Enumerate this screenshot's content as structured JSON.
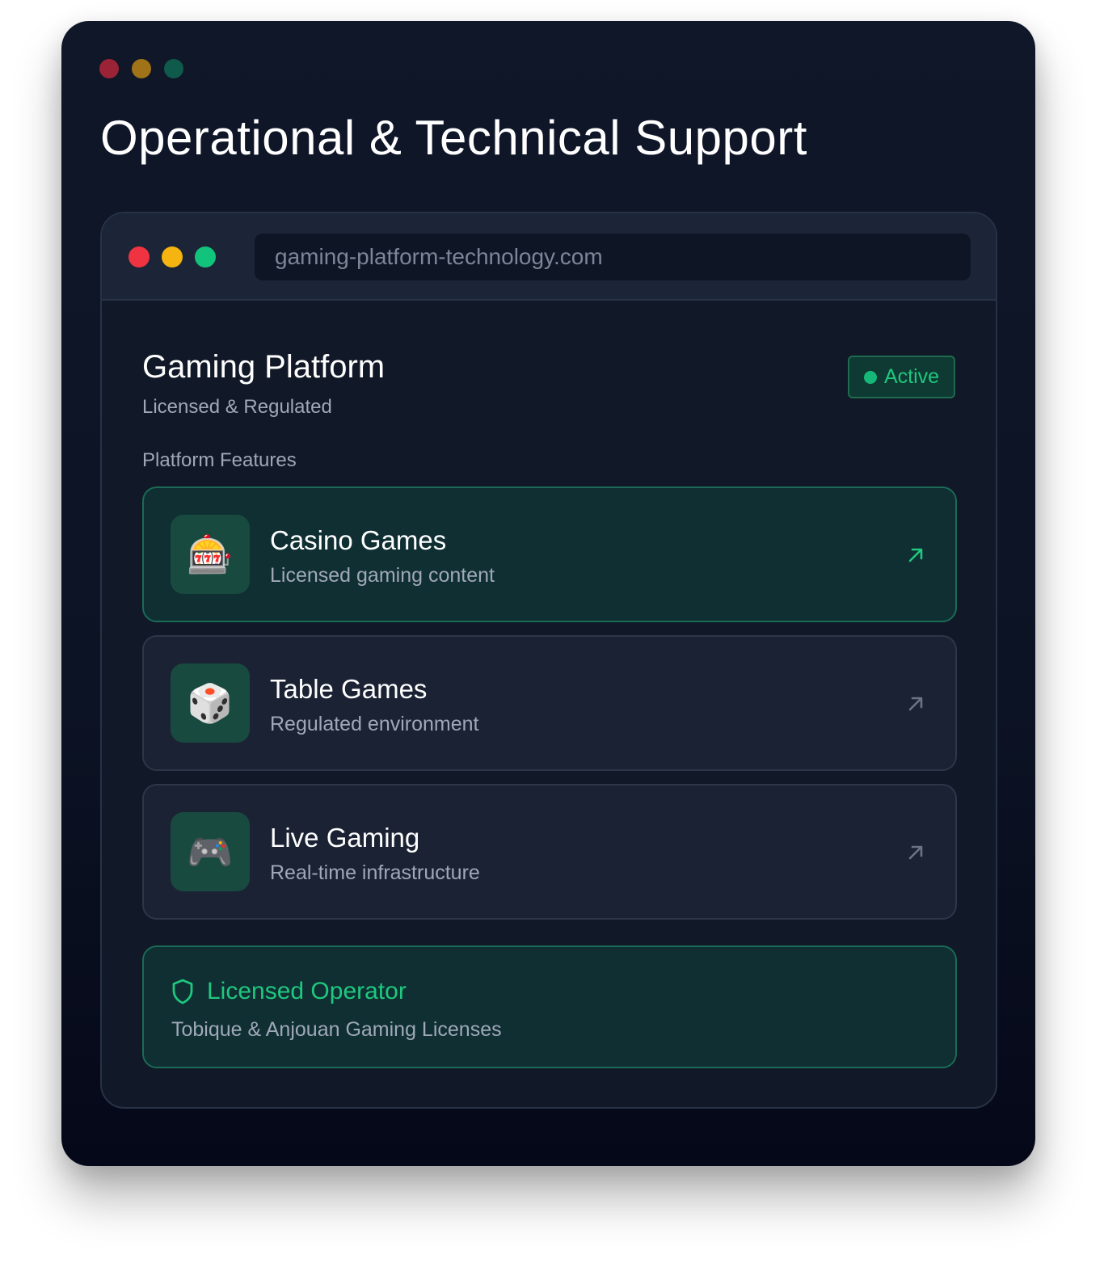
{
  "window": {
    "title": "Operational & Technical Support",
    "dots": [
      "#9b2335",
      "#a07318",
      "#0f5a4a"
    ]
  },
  "browser": {
    "url": "gaming-platform-technology.com",
    "dots": [
      "#ef3340",
      "#f5b40f",
      "#12c37c"
    ]
  },
  "platform": {
    "title": "Gaming Platform",
    "subtitle": "Licensed & Regulated",
    "status": "Active",
    "section_label": "Platform Features"
  },
  "features": [
    {
      "title": "Casino Games",
      "description": "Licensed gaming content",
      "icon": "slot-machine-icon",
      "glyph": "🎰",
      "active": true
    },
    {
      "title": "Table Games",
      "description": "Regulated environment",
      "icon": "dice-icon",
      "glyph": "🎲",
      "active": false
    },
    {
      "title": "Live Gaming",
      "description": "Real-time infrastructure",
      "icon": "gamepad-icon",
      "glyph": "🎮",
      "active": false
    }
  ],
  "license": {
    "title": "Licensed Operator",
    "description": "Tobique & Anjouan Gaming Licenses",
    "icon": "shield-icon"
  },
  "colors": {
    "accent": "#20c77e",
    "background": "#0f1729",
    "card": "#1a2233",
    "card_active": "#0f2f33"
  }
}
